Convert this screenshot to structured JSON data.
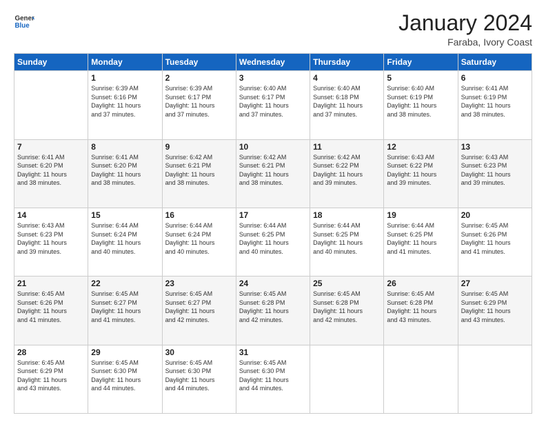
{
  "logo": {
    "line1": "General",
    "line2": "Blue"
  },
  "title": "January 2024",
  "subtitle": "Faraba, Ivory Coast",
  "days_header": [
    "Sunday",
    "Monday",
    "Tuesday",
    "Wednesday",
    "Thursday",
    "Friday",
    "Saturday"
  ],
  "weeks": [
    [
      {
        "num": "",
        "info": ""
      },
      {
        "num": "1",
        "info": "Sunrise: 6:39 AM\nSunset: 6:16 PM\nDaylight: 11 hours\nand 37 minutes."
      },
      {
        "num": "2",
        "info": "Sunrise: 6:39 AM\nSunset: 6:17 PM\nDaylight: 11 hours\nand 37 minutes."
      },
      {
        "num": "3",
        "info": "Sunrise: 6:40 AM\nSunset: 6:17 PM\nDaylight: 11 hours\nand 37 minutes."
      },
      {
        "num": "4",
        "info": "Sunrise: 6:40 AM\nSunset: 6:18 PM\nDaylight: 11 hours\nand 37 minutes."
      },
      {
        "num": "5",
        "info": "Sunrise: 6:40 AM\nSunset: 6:19 PM\nDaylight: 11 hours\nand 38 minutes."
      },
      {
        "num": "6",
        "info": "Sunrise: 6:41 AM\nSunset: 6:19 PM\nDaylight: 11 hours\nand 38 minutes."
      }
    ],
    [
      {
        "num": "7",
        "info": "Sunrise: 6:41 AM\nSunset: 6:20 PM\nDaylight: 11 hours\nand 38 minutes."
      },
      {
        "num": "8",
        "info": "Sunrise: 6:41 AM\nSunset: 6:20 PM\nDaylight: 11 hours\nand 38 minutes."
      },
      {
        "num": "9",
        "info": "Sunrise: 6:42 AM\nSunset: 6:21 PM\nDaylight: 11 hours\nand 38 minutes."
      },
      {
        "num": "10",
        "info": "Sunrise: 6:42 AM\nSunset: 6:21 PM\nDaylight: 11 hours\nand 38 minutes."
      },
      {
        "num": "11",
        "info": "Sunrise: 6:42 AM\nSunset: 6:22 PM\nDaylight: 11 hours\nand 39 minutes."
      },
      {
        "num": "12",
        "info": "Sunrise: 6:43 AM\nSunset: 6:22 PM\nDaylight: 11 hours\nand 39 minutes."
      },
      {
        "num": "13",
        "info": "Sunrise: 6:43 AM\nSunset: 6:23 PM\nDaylight: 11 hours\nand 39 minutes."
      }
    ],
    [
      {
        "num": "14",
        "info": "Sunrise: 6:43 AM\nSunset: 6:23 PM\nDaylight: 11 hours\nand 39 minutes."
      },
      {
        "num": "15",
        "info": "Sunrise: 6:44 AM\nSunset: 6:24 PM\nDaylight: 11 hours\nand 40 minutes."
      },
      {
        "num": "16",
        "info": "Sunrise: 6:44 AM\nSunset: 6:24 PM\nDaylight: 11 hours\nand 40 minutes."
      },
      {
        "num": "17",
        "info": "Sunrise: 6:44 AM\nSunset: 6:25 PM\nDaylight: 11 hours\nand 40 minutes."
      },
      {
        "num": "18",
        "info": "Sunrise: 6:44 AM\nSunset: 6:25 PM\nDaylight: 11 hours\nand 40 minutes."
      },
      {
        "num": "19",
        "info": "Sunrise: 6:44 AM\nSunset: 6:25 PM\nDaylight: 11 hours\nand 41 minutes."
      },
      {
        "num": "20",
        "info": "Sunrise: 6:45 AM\nSunset: 6:26 PM\nDaylight: 11 hours\nand 41 minutes."
      }
    ],
    [
      {
        "num": "21",
        "info": "Sunrise: 6:45 AM\nSunset: 6:26 PM\nDaylight: 11 hours\nand 41 minutes."
      },
      {
        "num": "22",
        "info": "Sunrise: 6:45 AM\nSunset: 6:27 PM\nDaylight: 11 hours\nand 41 minutes."
      },
      {
        "num": "23",
        "info": "Sunrise: 6:45 AM\nSunset: 6:27 PM\nDaylight: 11 hours\nand 42 minutes."
      },
      {
        "num": "24",
        "info": "Sunrise: 6:45 AM\nSunset: 6:28 PM\nDaylight: 11 hours\nand 42 minutes."
      },
      {
        "num": "25",
        "info": "Sunrise: 6:45 AM\nSunset: 6:28 PM\nDaylight: 11 hours\nand 42 minutes."
      },
      {
        "num": "26",
        "info": "Sunrise: 6:45 AM\nSunset: 6:28 PM\nDaylight: 11 hours\nand 43 minutes."
      },
      {
        "num": "27",
        "info": "Sunrise: 6:45 AM\nSunset: 6:29 PM\nDaylight: 11 hours\nand 43 minutes."
      }
    ],
    [
      {
        "num": "28",
        "info": "Sunrise: 6:45 AM\nSunset: 6:29 PM\nDaylight: 11 hours\nand 43 minutes."
      },
      {
        "num": "29",
        "info": "Sunrise: 6:45 AM\nSunset: 6:30 PM\nDaylight: 11 hours\nand 44 minutes."
      },
      {
        "num": "30",
        "info": "Sunrise: 6:45 AM\nSunset: 6:30 PM\nDaylight: 11 hours\nand 44 minutes."
      },
      {
        "num": "31",
        "info": "Sunrise: 6:45 AM\nSunset: 6:30 PM\nDaylight: 11 hours\nand 44 minutes."
      },
      {
        "num": "",
        "info": ""
      },
      {
        "num": "",
        "info": ""
      },
      {
        "num": "",
        "info": ""
      }
    ]
  ]
}
